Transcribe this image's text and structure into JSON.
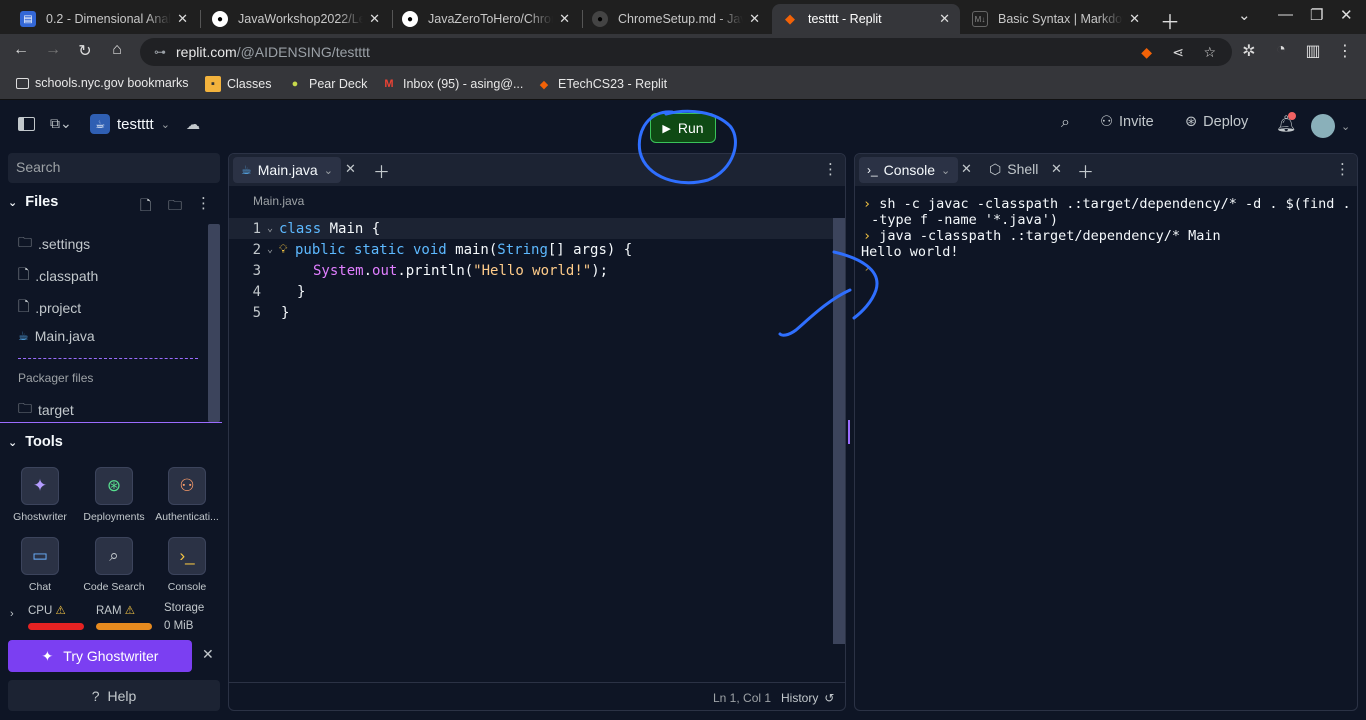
{
  "browser": {
    "tabs": [
      {
        "title": "0.2 - Dimensional Analy",
        "icon": "slides-icon"
      },
      {
        "title": "JavaWorkshop2022/Le",
        "icon": "github-icon"
      },
      {
        "title": "JavaZeroToHero/Chron",
        "icon": "github-icon"
      },
      {
        "title": "ChromeSetup.md - Java",
        "icon": "github-icon"
      },
      {
        "title": "testttt - Replit",
        "icon": "replit-icon"
      },
      {
        "title": "Basic Syntax | Markdow",
        "icon": "markdown-icon"
      }
    ],
    "active_tab": 4,
    "url_host": "replit.com",
    "url_path": "/@AIDENSING/testttt",
    "bookmarks": [
      "schools.nyc.gov bookmarks",
      "Classes",
      "Pear Deck",
      "Inbox (95) - asing@...",
      "ETechCS23 - Replit"
    ]
  },
  "replit": {
    "repl_name": "testttt",
    "run_label": "Run",
    "invite_label": "Invite",
    "deploy_label": "Deploy",
    "search_placeholder": "Search",
    "files_title": "Files",
    "files": [
      ".settings",
      ".classpath",
      ".project",
      "Main.java"
    ],
    "packager_title": "Packager files",
    "packager_files": [
      "target"
    ],
    "tools_title": "Tools",
    "tools": [
      {
        "label": "Ghostwriter",
        "icon": "ghostwriter-icon"
      },
      {
        "label": "Deployments",
        "icon": "deployments-icon"
      },
      {
        "label": "Authenticati...",
        "icon": "user-icon"
      },
      {
        "label": "Chat",
        "icon": "chat-icon"
      },
      {
        "label": "Code Search",
        "icon": "search-icon"
      },
      {
        "label": "Console",
        "icon": "console-icon"
      }
    ],
    "resources": {
      "cpu": "CPU",
      "ram": "RAM",
      "storage": "Storage",
      "storage_value": "0 MiB",
      "cpu_level": 1.0,
      "ram_level": 1.0
    },
    "try_ghostwriter": "Try Ghostwriter",
    "help": "Help",
    "editor": {
      "tab": "Main.java",
      "breadcrumb": "Main.java",
      "status": "Ln 1, Col 1",
      "history": "History"
    },
    "console": {
      "tab_console": "Console",
      "tab_shell": "Shell",
      "lines": [
        "sh -c javac -classpath .:target/dependency/* -d . $(find .",
        " -type f -name '*.java')",
        "java -classpath .:target/dependency/* Main",
        "Hello world!"
      ]
    }
  }
}
